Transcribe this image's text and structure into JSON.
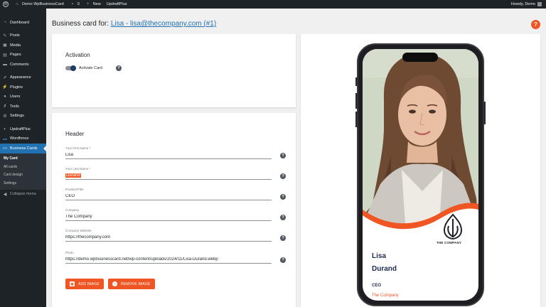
{
  "adminbar": {
    "site_name": "Demo WpBusinessCard",
    "comments_count": "0",
    "new_label": "New",
    "plugin_label": "UpdraftPlus",
    "howdy": "Howdy, Demo"
  },
  "sidebar": {
    "items": [
      {
        "label": "Dashboard",
        "icon": "dashboard-icon"
      },
      {
        "label": "Posts",
        "icon": "pin-icon"
      },
      {
        "label": "Media",
        "icon": "media-icon"
      },
      {
        "label": "Pages",
        "icon": "pages-icon"
      },
      {
        "label": "Comments",
        "icon": "comment-icon"
      },
      {
        "label": "Appearance",
        "icon": "brush-icon"
      },
      {
        "label": "Plugins",
        "icon": "plugin-icon"
      },
      {
        "label": "Users",
        "icon": "user-icon"
      },
      {
        "label": "Tools",
        "icon": "wrench-icon"
      },
      {
        "label": "Settings",
        "icon": "settings-icon"
      },
      {
        "label": "UpdraftPlus",
        "icon": "updraft-icon"
      },
      {
        "label": "Wordfence",
        "icon": "wordfence-icon"
      },
      {
        "label": "Business Cards",
        "icon": "card-icon"
      }
    ],
    "submenu": [
      "My Card",
      "All cards",
      "Card design",
      "Settings"
    ],
    "collapse_label": "Collapse menu"
  },
  "page": {
    "title_prefix": "Business card for:",
    "title_link": "Lisa - lisa@thecompany.com (#1)",
    "help_label": "?"
  },
  "activation": {
    "heading": "Activation",
    "toggle_label": "Activate Card",
    "toggle_on": true
  },
  "header_section": {
    "heading": "Header",
    "fields": [
      {
        "label": "Your First Name *",
        "value": "Lisa"
      },
      {
        "label": "Your Last Name *",
        "value": "Durand"
      },
      {
        "label": "Position/Title",
        "value": "CEO"
      },
      {
        "label": "Company",
        "value": "The Company"
      },
      {
        "label": "Company Website",
        "value": "https://thecompany.com"
      },
      {
        "label": "Photo",
        "value": "https://demo.wpbusinesscard.net/wp-content/uploads/2024/11/Lisa-Durand.webp"
      }
    ],
    "add_image": "ADD IMAGE",
    "remove_image": "REMOVE IMAGE"
  },
  "preview": {
    "company_logo_text": "THE COMPANY",
    "first_name": "Lisa",
    "last_name": "Durand",
    "title": "CEO",
    "company": "The Company"
  },
  "colors": {
    "accent": "#f05623",
    "wp_blue": "#2271b1",
    "sidebar_bg": "#1d2327",
    "name_color": "#1d2b4f"
  }
}
